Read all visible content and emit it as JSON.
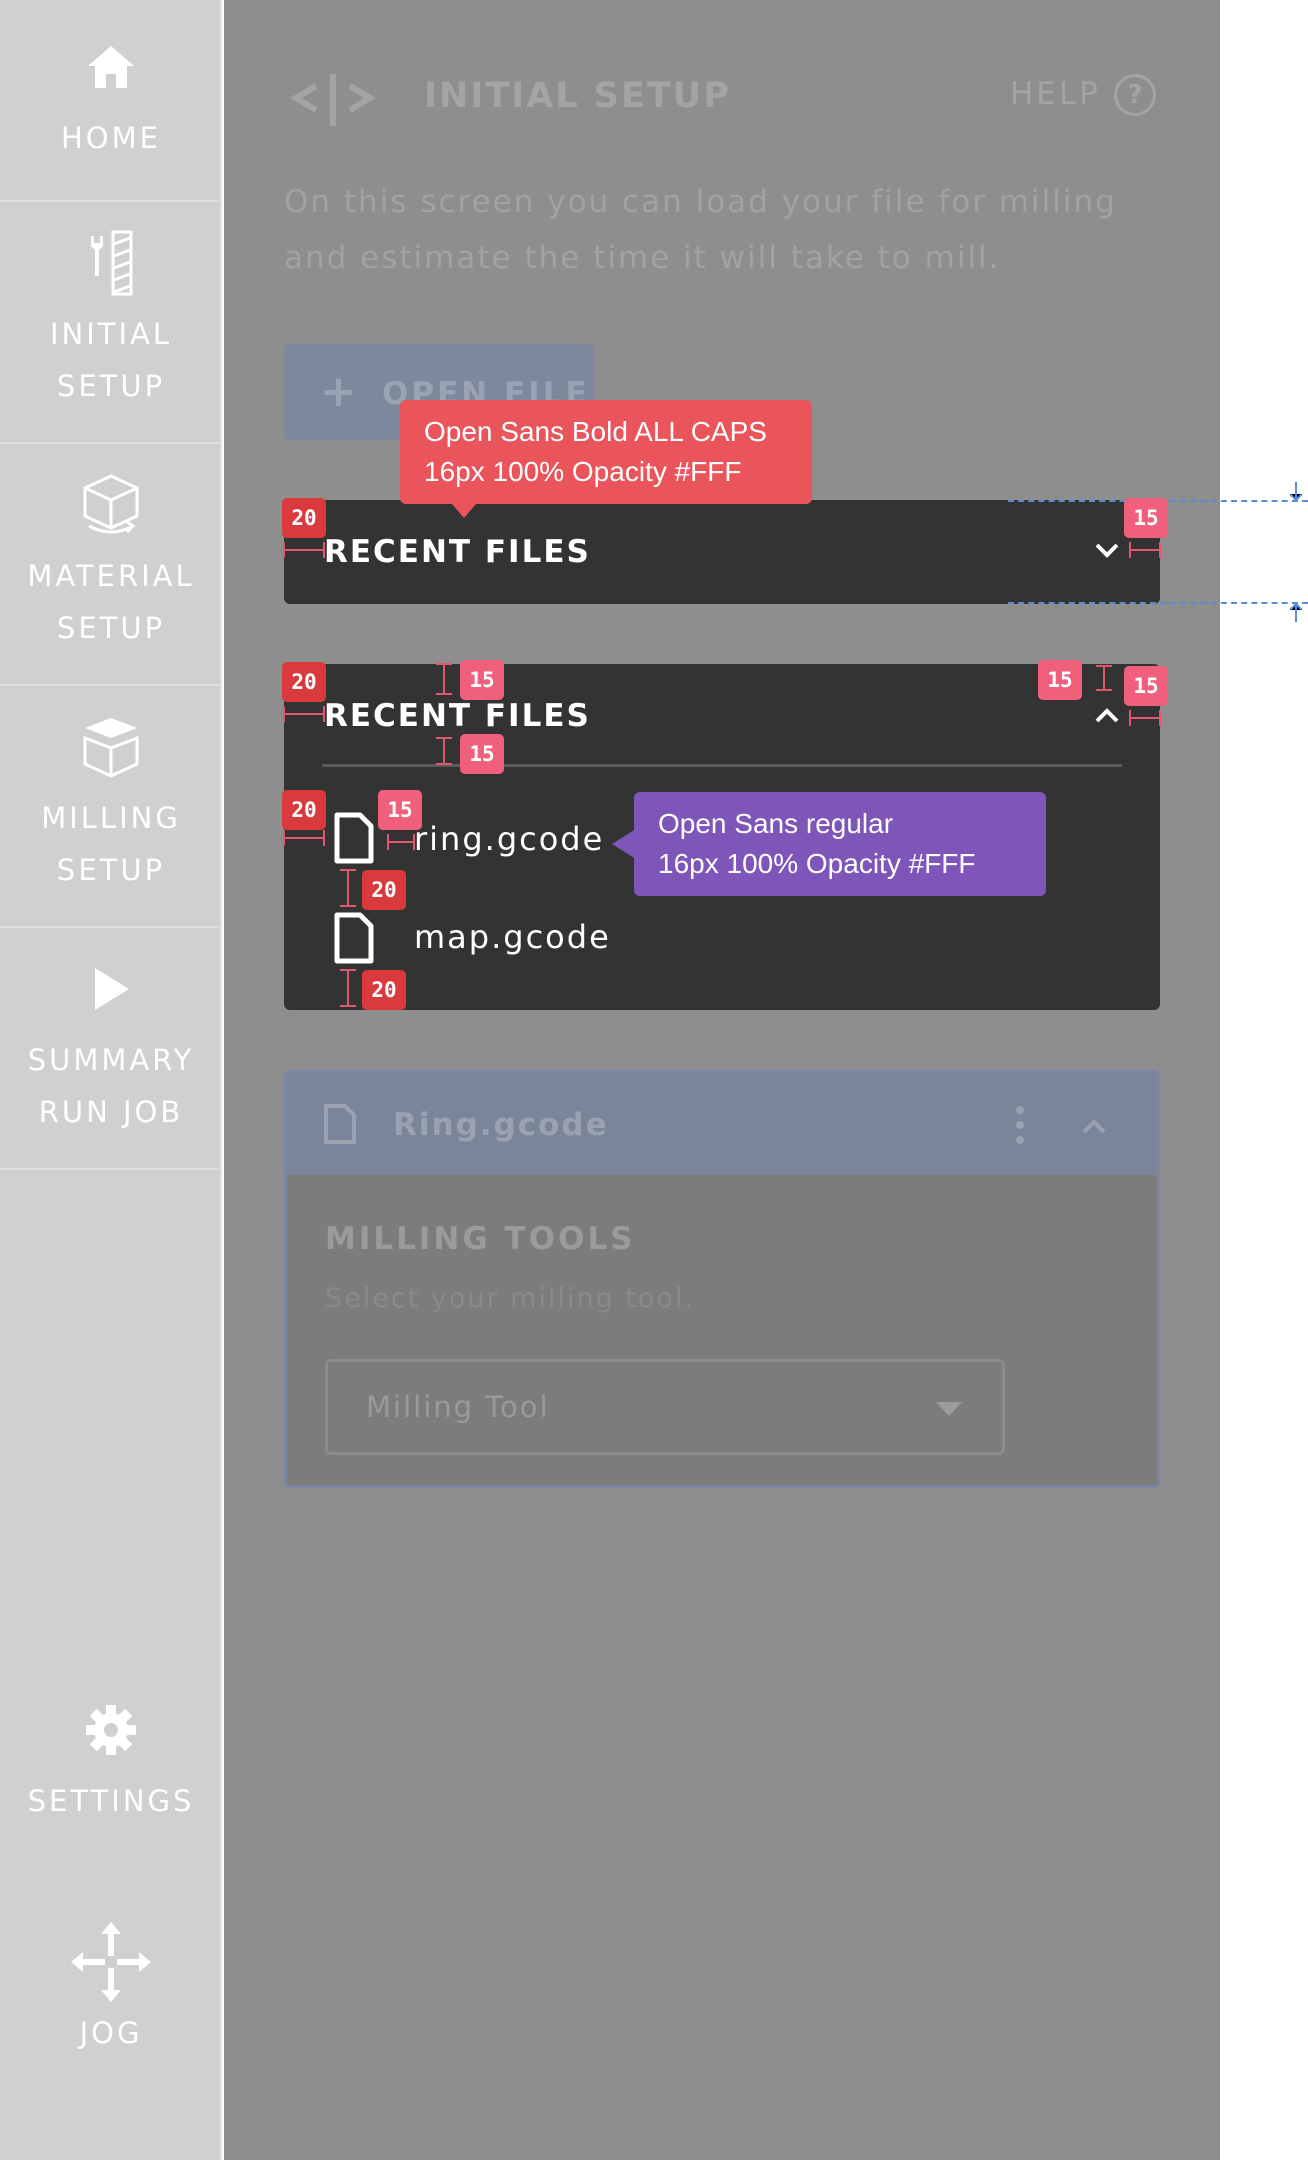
{
  "sidebar": {
    "items": [
      {
        "label": "HOME",
        "icon": "home-icon"
      },
      {
        "label": "INITIAL\nSETUP",
        "icon": "tools-icon"
      },
      {
        "label": "MATERIAL\nSETUP",
        "icon": "cube-rotate-icon"
      },
      {
        "label": "MILLING\nSETUP",
        "icon": "layers-cube-icon"
      },
      {
        "label": "SUMMARY\nRUN JOB",
        "icon": "play-icon"
      },
      {
        "label": "SETTINGS",
        "icon": "gear-icon"
      },
      {
        "label": "JOG",
        "icon": "move-arrows-icon"
      }
    ]
  },
  "header": {
    "title": "INITIAL SETUP",
    "help_label": "HELP",
    "help_icon_glyph": "?"
  },
  "intro": "On this screen you can load your file for milling and estimate the time it will take to mill.",
  "open_file": {
    "plus": "+",
    "label": "OPEN FILE"
  },
  "recent_collapsed": {
    "title": "RECENT FILES"
  },
  "recent_expanded": {
    "title": "RECENT FILES",
    "files": [
      "ring.gcode",
      "map.gcode"
    ]
  },
  "file_card": {
    "file_name": "Ring.gcode",
    "section_title": "MILLING TOOLS",
    "section_hint": "Select your milling tool.",
    "select_value": "Milling Tool"
  },
  "annotations": {
    "tip_title_line1": "Open Sans Bold ALL CAPS",
    "tip_title_line2": "16px 100% Opacity #FFF",
    "tip_item_line1": "Open Sans regular",
    "tip_item_line2": "16px 100% Opacity #FFF",
    "b20": "20",
    "b15": "15"
  },
  "colors": {
    "sidebar_bg": "#d0d0d0",
    "main_dim": "#8e8e8e",
    "panel_dark": "#333333",
    "badge_red": "#d93a3e",
    "badge_pink": "#f0607c",
    "tip_red": "#e9555b",
    "tip_purple": "#7e55b8",
    "guide_blue": "#5a8bd6"
  }
}
